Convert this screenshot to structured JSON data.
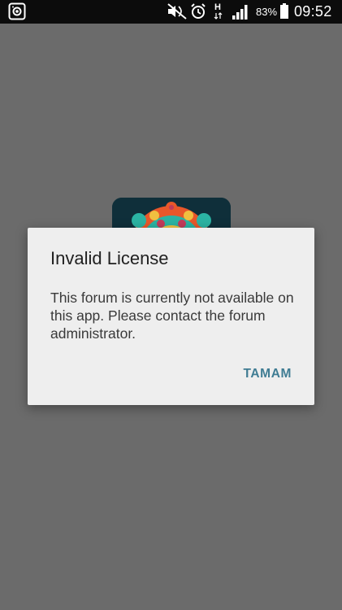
{
  "status_bar": {
    "icons": [
      "screen-recorder-icon",
      "mute-icon",
      "alarm-icon",
      "hspa-data-icon",
      "signal-icon",
      "battery-icon"
    ],
    "battery_percent": "83%",
    "time": "09:52",
    "network_label": "H"
  },
  "app_icon": {
    "icon": "app-launcher-icon",
    "colors": [
      "#0f2f3a",
      "#e8572a",
      "#2bb3a3",
      "#f0c040"
    ]
  },
  "dialog": {
    "title": "Invalid License",
    "message": "This forum is currently not available on this app. Please contact the forum administrator.",
    "positive_button": "TAMAM"
  },
  "colors": {
    "scrim": "#6b6b6b",
    "dialog_bg": "#eeeeee",
    "accent": "#3f7c93",
    "status_bar_bg": "#0c0c0c"
  }
}
